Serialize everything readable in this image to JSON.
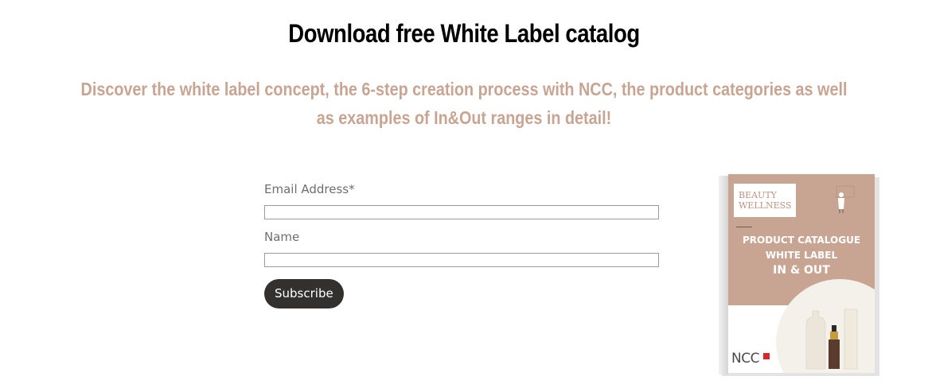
{
  "page": {
    "heading": "Download free White Label catalog",
    "subheading": "Discover the white label concept, the 6-step creation process with NCC, the product categories as well as examples of In&Out ranges in detail!",
    "subheading_color": "#c8a593"
  },
  "form": {
    "email_label": "Email Address*",
    "email_value": "",
    "name_label": "Name",
    "name_value": "",
    "subscribe_label": "Subscribe"
  },
  "catalogue": {
    "tag_line1": "BEAUTY",
    "tag_line2": "WELLNESS",
    "title_line1": "PRODUCT CATALOGUE",
    "title_line2": "WHITE LABEL",
    "title_line3": "IN & OUT",
    "logo": "NCC",
    "cover_color": "#c8a593"
  }
}
